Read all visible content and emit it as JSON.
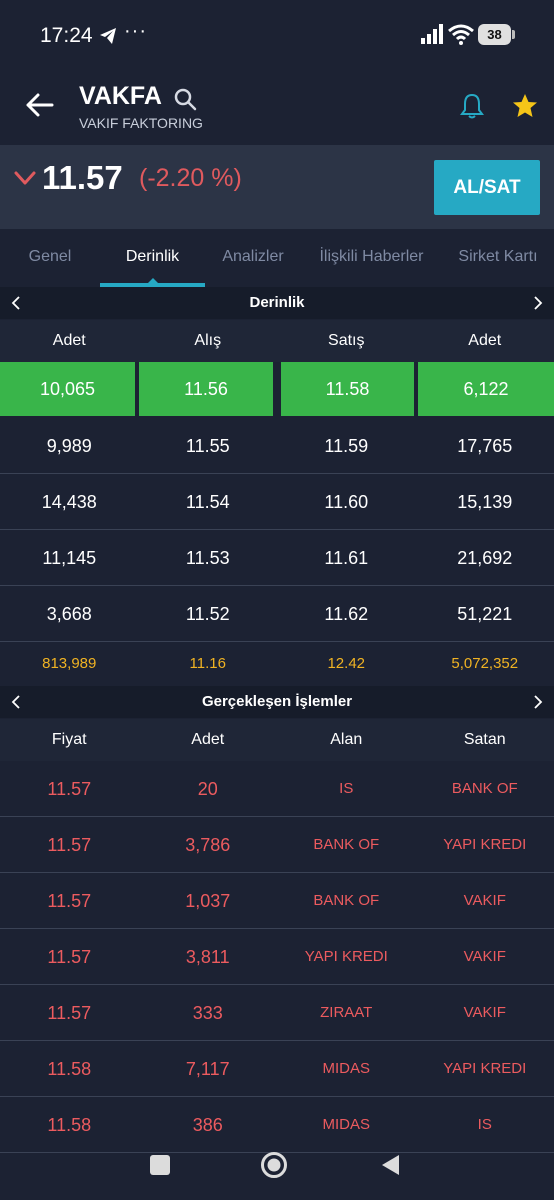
{
  "status_bar": {
    "time": "17:24",
    "dots": "···",
    "battery": "38"
  },
  "header": {
    "symbol": "VAKFA",
    "full_name": "VAKIF FAKTORING"
  },
  "price": {
    "last": "11.57",
    "change_pct": "(-2.20 %)",
    "direction": "down",
    "buy_sell_label": "AL/SAT"
  },
  "tabs": [
    {
      "label": "Genel",
      "active": false
    },
    {
      "label": "Derinlik",
      "active": true
    },
    {
      "label": "Analizler",
      "active": false
    },
    {
      "label": "İlişkili Haberler",
      "active": false
    },
    {
      "label": "Sirket Kartı",
      "active": false
    }
  ],
  "depth": {
    "title": "Derinlik",
    "columns": [
      "Adet",
      "Alış",
      "Satış",
      "Adet"
    ],
    "best": [
      "10,065",
      "11.56",
      "11.58",
      "6,122"
    ],
    "rows": [
      [
        "9,989",
        "11.55",
        "11.59",
        "17,765"
      ],
      [
        "14,438",
        "11.54",
        "11.60",
        "15,139"
      ],
      [
        "11,145",
        "11.53",
        "11.61",
        "21,692"
      ],
      [
        "3,668",
        "11.52",
        "11.62",
        "51,221"
      ]
    ],
    "totals": [
      "813,989",
      "11.16",
      "12.42",
      "5,072,352"
    ]
  },
  "trades": {
    "title": "Gerçekleşen İşlemler",
    "columns": [
      "Fiyat",
      "Adet",
      "Alan",
      "Satan"
    ],
    "rows": [
      [
        "11.57",
        "20",
        "IS",
        "BANK OF"
      ],
      [
        "11.57",
        "3,786",
        "BANK OF",
        "YAPI KREDI"
      ],
      [
        "11.57",
        "1,037",
        "BANK OF",
        "VAKIF"
      ],
      [
        "11.57",
        "3,811",
        "YAPI KREDI",
        "VAKIF"
      ],
      [
        "11.57",
        "333",
        "ZIRAAT",
        "VAKIF"
      ],
      [
        "11.58",
        "7,117",
        "MIDAS",
        "YAPI KREDI"
      ],
      [
        "11.58",
        "386",
        "MIDAS",
        "IS"
      ]
    ]
  },
  "colors": {
    "accent": "#26a9c4",
    "up_green": "#39b54a",
    "down_red": "#ec5b5f",
    "total_yellow": "#f0b323",
    "star": "#f5c518"
  }
}
